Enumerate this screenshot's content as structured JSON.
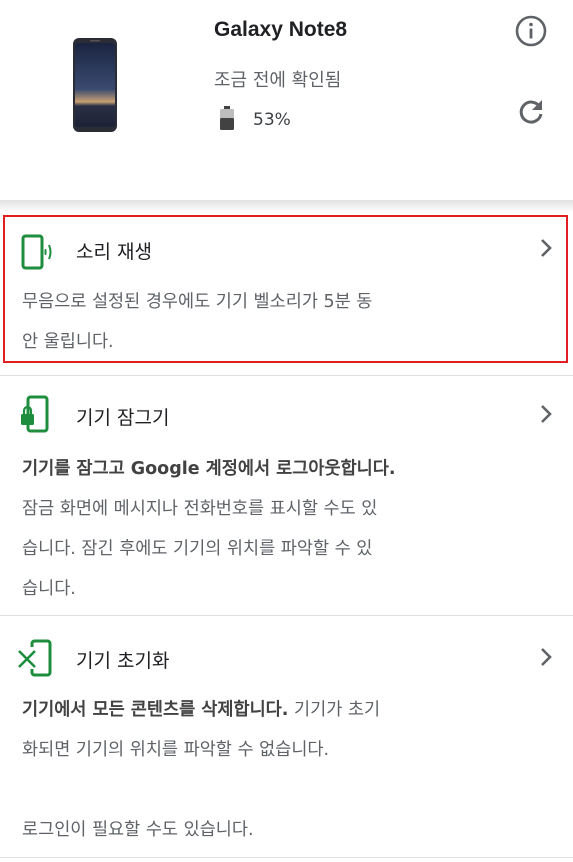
{
  "device": {
    "name": "Galaxy Note8",
    "status": "조금 전에 확인됨",
    "battery": "53%"
  },
  "icons": {
    "info": "info-icon",
    "refresh": "refresh-icon",
    "play_sound": "phone-ringing-icon",
    "lock": "phone-lock-icon",
    "erase": "phone-erase-icon",
    "chevron": "chevron-right-icon"
  },
  "colors": {
    "accent_green": "#1e8e3e",
    "highlight_red": "#e02020"
  },
  "options": [
    {
      "title": "소리 재생",
      "desc_line1": "무음으로 설정된 경우에도 기기 벨소리가 5분 동",
      "desc_line2": "안 울립니다."
    },
    {
      "title": "기기 잠그기",
      "bold": "기기를 잠그고 Google 계정에서 로그아웃합니다.",
      "line2": "잠금 화면에 메시지나 전화번호를 표시할 수도 있",
      "line3": "습니다. 잠긴 후에도 기기의 위치를 파악할 수 있",
      "line4": "습니다."
    },
    {
      "title": "기기 초기화",
      "bold": "기기에서 모든 콘텐츠를 삭제합니다.",
      "line1_rest": " 기기가 초기",
      "line2": "화되면 기기의 위치를 파악할 수 없습니다.",
      "line3": "로그인이 필요할 수도 있습니다."
    }
  ]
}
